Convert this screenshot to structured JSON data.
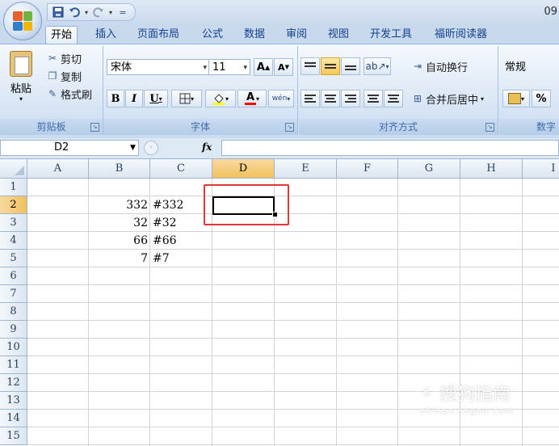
{
  "window": {
    "title_fragment": "09"
  },
  "quick_access": {
    "save_icon": "save-icon",
    "undo_icon": "undo-icon",
    "redo_icon": "redo-icon",
    "customize_glyph": "="
  },
  "tabs": [
    {
      "label": "开始",
      "active": true
    },
    {
      "label": "插入"
    },
    {
      "label": "页面布局"
    },
    {
      "label": "公式"
    },
    {
      "label": "数据"
    },
    {
      "label": "审阅"
    },
    {
      "label": "视图"
    },
    {
      "label": "开发工具"
    },
    {
      "label": "福昕阅读器"
    }
  ],
  "ribbon": {
    "clipboard": {
      "group_label": "剪贴板",
      "paste": "粘贴",
      "cut": "剪切",
      "copy": "复制",
      "format_painter": "格式刷"
    },
    "font": {
      "group_label": "字体",
      "font_name": "宋体",
      "font_size": "11",
      "grow": "A",
      "shrink": "A",
      "bold": "B",
      "italic": "I",
      "underline": "U",
      "font_color_letter": "A",
      "phonetic": "wén"
    },
    "alignment": {
      "group_label": "对齐方式",
      "wrap_text": "自动换行",
      "merge_center": "合并后居中"
    },
    "number": {
      "group_label": "数字",
      "format": "常规",
      "percent": "%"
    }
  },
  "formula_bar": {
    "name_box": "D2",
    "fx": "fx",
    "value": ""
  },
  "sheet": {
    "columns": [
      "A",
      "B",
      "C",
      "D",
      "E",
      "F",
      "G",
      "H",
      "I"
    ],
    "rows": [
      "1",
      "2",
      "3",
      "4",
      "5",
      "6",
      "7",
      "8",
      "9",
      "10",
      "11",
      "12",
      "13",
      "14",
      "15"
    ],
    "selected_cell": "D2",
    "cells": {
      "B2": "332",
      "C2": "#332",
      "B3": "32",
      "C3": "#32",
      "B4": "66",
      "C4": "#66",
      "B5": "7",
      "C5": "#7"
    }
  },
  "watermark": {
    "main": "搜狗指南",
    "sub": "zhinan.sogou.com",
    "logo_glyph": "S"
  },
  "colors": {
    "highlight": "#e3373b",
    "accent": "#15428b",
    "selected_header": "#f1c15f"
  }
}
